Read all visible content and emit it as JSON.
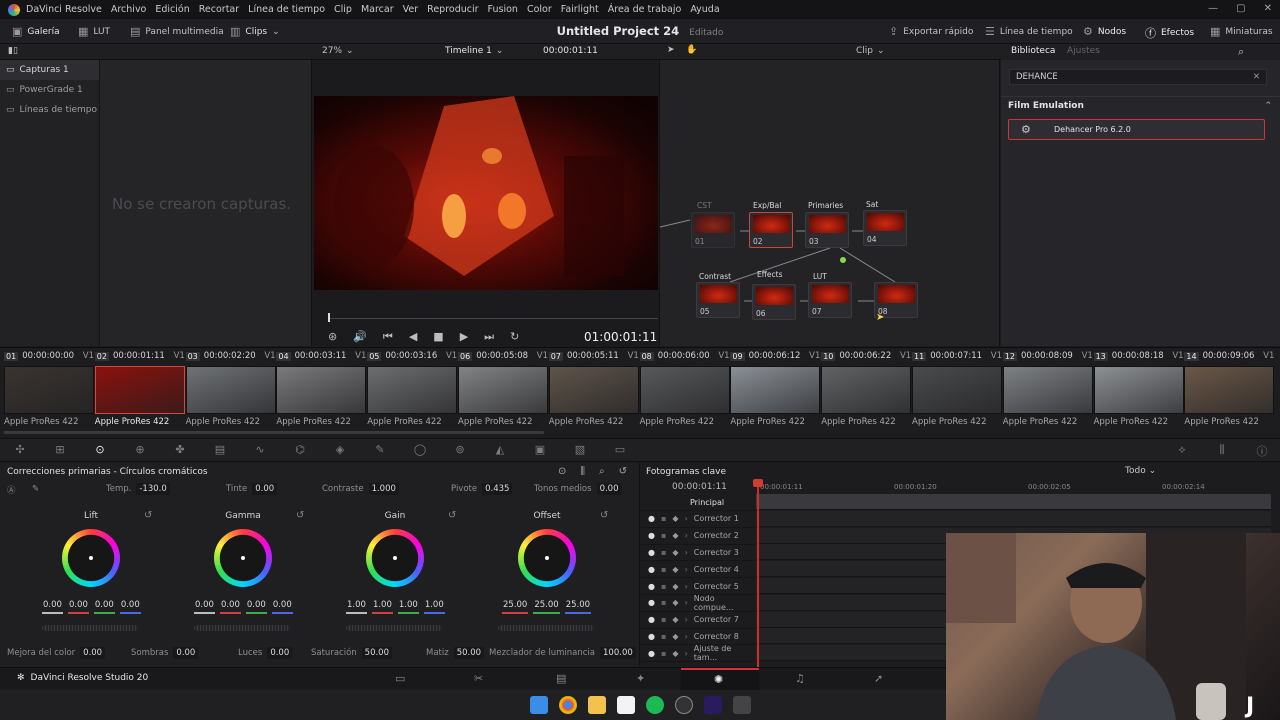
{
  "app": {
    "name": "DaVinci Resolve",
    "studio_label": "DaVinci Resolve Studio 20"
  },
  "menu": [
    "DaVinci Resolve",
    "Archivo",
    "Edición",
    "Recortar",
    "Línea de tiempo",
    "Clip",
    "Marcar",
    "Ver",
    "Reproducir",
    "Fusion",
    "Color",
    "Fairlight",
    "Área de trabajo",
    "Ayuda"
  ],
  "toolbar": {
    "gallery": "Galería",
    "lut": "LUT",
    "media": "Panel multimedia",
    "clips": "Clips",
    "project_title": "Untitled Project 24",
    "project_status": "Editado",
    "export": "Exportar rápido",
    "timeline": "Línea de tiempo",
    "nodes": "Nodos",
    "effects": "Efectos",
    "thumbs": "Miniaturas"
  },
  "subbar": {
    "zoom": "27%",
    "timeline_name": "Timeline 1",
    "timecode": "00:00:01:11",
    "clip_mode": "Clip",
    "library_tab": "Biblioteca",
    "settings_tab": "Ajustes"
  },
  "gallery": {
    "albums": [
      "Capturas 1",
      "PowerGrade 1",
      "Líneas de tiempo"
    ],
    "empty": "No se crearon capturas."
  },
  "viewer": {
    "timecode": "01:00:01:11"
  },
  "nodes": [
    {
      "label": "CST",
      "num": "01"
    },
    {
      "label": "Exp/Bal",
      "num": "02"
    },
    {
      "label": "Primaries",
      "num": "03"
    },
    {
      "label": "Sat",
      "num": "04"
    },
    {
      "label": "Contrast",
      "num": "05"
    },
    {
      "label": "Effects",
      "num": "06"
    },
    {
      "label": "LUT",
      "num": "07"
    },
    {
      "label": "",
      "num": "08"
    }
  ],
  "library": {
    "search": "DEHANCE",
    "section": "Film Emulation",
    "item": "Dehancer Pro 6.2.0"
  },
  "clips": [
    {
      "n": "01",
      "tc": "00:00:00:00",
      "track": "V1",
      "codec": "Apple ProRes 422",
      "color": "#3a3430"
    },
    {
      "n": "02",
      "tc": "00:00:01:11",
      "track": "V1",
      "codec": "Apple ProRes 422",
      "color": "#8a120c"
    },
    {
      "n": "03",
      "tc": "00:00:02:20",
      "track": "V1",
      "codec": "Apple ProRes 422",
      "color": "#6f7276"
    },
    {
      "n": "04",
      "tc": "00:00:03:11",
      "track": "V1",
      "codec": "Apple ProRes 422",
      "color": "#7a7a7c"
    },
    {
      "n": "05",
      "tc": "00:00:03:16",
      "track": "V1",
      "codec": "Apple ProRes 422",
      "color": "#6d6e70"
    },
    {
      "n": "06",
      "tc": "00:00:05:08",
      "track": "V1",
      "codec": "Apple ProRes 422",
      "color": "#828385"
    },
    {
      "n": "07",
      "tc": "00:00:05:11",
      "track": "V1",
      "codec": "Apple ProRes 422",
      "color": "#5e544a"
    },
    {
      "n": "08",
      "tc": "00:00:06:00",
      "track": "V1",
      "codec": "Apple ProRes 422",
      "color": "#58595a"
    },
    {
      "n": "09",
      "tc": "00:00:06:12",
      "track": "V1",
      "codec": "Apple ProRes 422",
      "color": "#8b9096"
    },
    {
      "n": "10",
      "tc": "00:00:06:22",
      "track": "V1",
      "codec": "Apple ProRes 422",
      "color": "#606264"
    },
    {
      "n": "11",
      "tc": "00:00:07:11",
      "track": "V1",
      "codec": "Apple ProRes 422",
      "color": "#4a4b4d"
    },
    {
      "n": "12",
      "tc": "00:00:08:09",
      "track": "V1",
      "codec": "Apple ProRes 422",
      "color": "#7e8184"
    },
    {
      "n": "13",
      "tc": "00:00:08:18",
      "track": "V1",
      "codec": "Apple ProRes 422",
      "color": "#8d9093"
    },
    {
      "n": "14",
      "tc": "00:00:09:06",
      "track": "V1",
      "codec": "Apple ProRes 422",
      "color": "#6a5848"
    }
  ],
  "primary": {
    "title": "Correcciones primarias - Círculos cromáticos",
    "temp_label": "Temp.",
    "temp": "-130.0",
    "tint_label": "Tinte",
    "tint": "0.00",
    "contrast_label": "Contraste",
    "contrast": "1.000",
    "pivot_label": "Pivote",
    "pivot": "0.435",
    "mid_label": "Tonos medios",
    "mid": "0.00",
    "wheels": [
      {
        "name": "Lift",
        "vals": [
          "0.00",
          "0.00",
          "0.00",
          "0.00"
        ]
      },
      {
        "name": "Gamma",
        "vals": [
          "0.00",
          "0.00",
          "0.00",
          "0.00"
        ]
      },
      {
        "name": "Gain",
        "vals": [
          "1.00",
          "1.00",
          "1.00",
          "1.00"
        ]
      },
      {
        "name": "Offset",
        "vals": [
          "25.00",
          "25.00",
          "25.00"
        ]
      }
    ],
    "bottom": [
      {
        "label": "Mejora del color",
        "val": "0.00"
      },
      {
        "label": "Sombras",
        "val": "0.00"
      },
      {
        "label": "Luces",
        "val": "0.00"
      },
      {
        "label": "Saturación",
        "val": "50.00"
      },
      {
        "label": "Matiz",
        "val": "50.00"
      },
      {
        "label": "Mezclador de luminancia",
        "val": "100.00"
      }
    ]
  },
  "keyframes": {
    "title": "Fotogramas clave",
    "filter": "Todo",
    "tc": "00:00:01:11",
    "ruler": [
      "00:00:01:11",
      "00:00:01:20",
      "00:00:02:05",
      "00:00:02:14"
    ],
    "rows": [
      "Principal",
      "Corrector 1",
      "Corrector 2",
      "Corrector 3",
      "Corrector 4",
      "Corrector 5",
      "Nodo compue...",
      "Corrector 7",
      "Corrector 8",
      "Ajuste de tam..."
    ]
  }
}
